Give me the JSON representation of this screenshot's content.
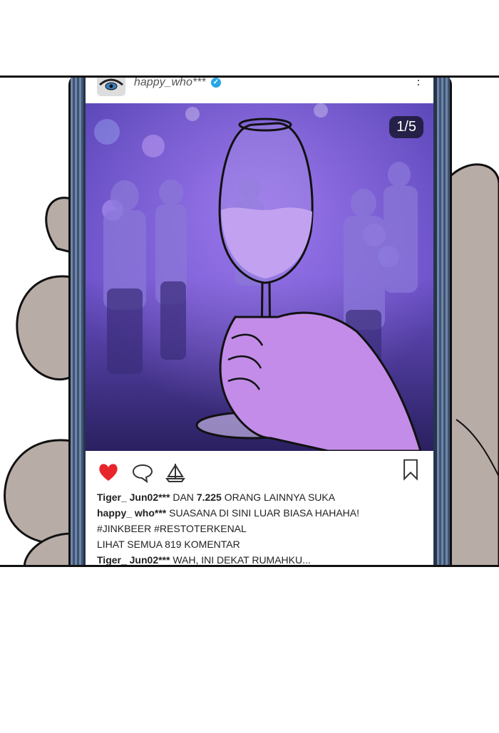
{
  "post": {
    "username": "happy_who***",
    "page_counter": "1/5",
    "likes_line": {
      "user": "Tiger_ Jun02***",
      "prefix": "DAN",
      "count": "7.225",
      "suffix": "ORANG LAINNYA SUKA"
    },
    "caption": {
      "user": "happy_ who***",
      "text": "SUASANA DI SINI LUAR BIASA HAHAHA!",
      "hashtags": "#JINKBEER #RESTOTERKENAL"
    },
    "view_comments": "LIHAT SEMUA 819 KOMENTAR",
    "comment": {
      "user": "Tiger_ Jun02***",
      "text": "WAH, INI DEKAT RUMAHKU..."
    }
  },
  "icons": {
    "like": "heart-icon",
    "comment": "speech-bubble-icon",
    "share": "sail-boat-icon",
    "save": "bookmark-icon",
    "more": "more-dots-icon",
    "verified": "verified-badge-icon"
  },
  "colors": {
    "like": "#e8252b",
    "verified": "#27a7e8",
    "image_tint": "#7b4cd6"
  }
}
